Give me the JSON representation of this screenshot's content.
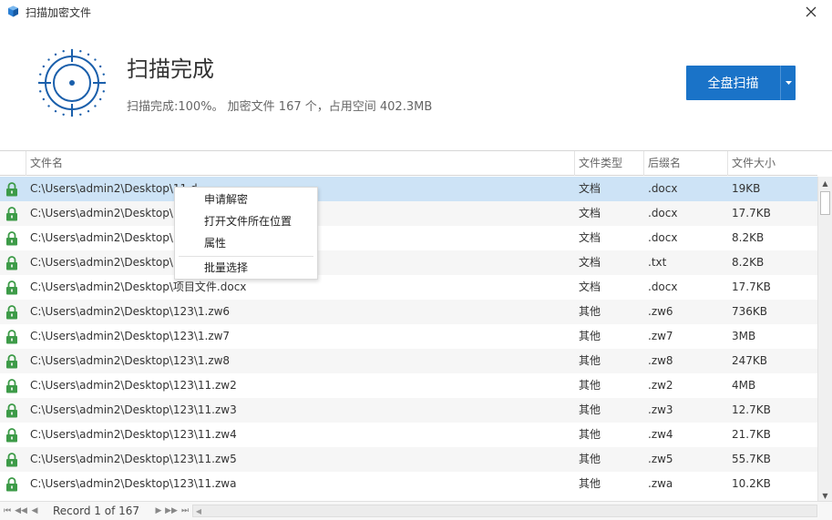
{
  "window": {
    "title": "扫描加密文件",
    "app_icon": "shield-app-icon",
    "close_icon": "close-icon"
  },
  "header": {
    "scan_title": "扫描完成",
    "summary": "扫描完成:100%。 加密文件 167 个，占用空间 402.3MB",
    "full_scan_label": "全盘扫描",
    "full_scan_dropdown_icon": "caret-down-icon",
    "accent_color": "#1a73c8"
  },
  "table": {
    "columns": [
      "文件名",
      "文件类型",
      "后缀名",
      "文件大小"
    ],
    "rows": [
      {
        "name": "C:\\Users\\admin2\\Desktop\\11.d",
        "type": "文档",
        "ext": ".docx",
        "size": "19KB"
      },
      {
        "name": "C:\\Users\\admin2\\Desktop\\",
        "type": "文档",
        "ext": ".docx",
        "size": "17.7KB"
      },
      {
        "name": "C:\\Users\\admin2\\Desktop\\",
        "type": "文档",
        "ext": ".docx",
        "size": "8.2KB"
      },
      {
        "name": "C:\\Users\\admin2\\Desktop\\",
        "type": "文档",
        "ext": ".txt",
        "size": "8.2KB"
      },
      {
        "name": "C:\\Users\\admin2\\Desktop\\项目文件.docx",
        "type": "文档",
        "ext": ".docx",
        "size": "17.7KB"
      },
      {
        "name": "C:\\Users\\admin2\\Desktop\\123\\1.zw6",
        "type": "其他",
        "ext": ".zw6",
        "size": "736KB"
      },
      {
        "name": "C:\\Users\\admin2\\Desktop\\123\\1.zw7",
        "type": "其他",
        "ext": ".zw7",
        "size": "3MB"
      },
      {
        "name": "C:\\Users\\admin2\\Desktop\\123\\1.zw8",
        "type": "其他",
        "ext": ".zw8",
        "size": "247KB"
      },
      {
        "name": "C:\\Users\\admin2\\Desktop\\123\\11.zw2",
        "type": "其他",
        "ext": ".zw2",
        "size": "4MB"
      },
      {
        "name": "C:\\Users\\admin2\\Desktop\\123\\11.zw3",
        "type": "其他",
        "ext": ".zw3",
        "size": "12.7KB"
      },
      {
        "name": "C:\\Users\\admin2\\Desktop\\123\\11.zw4",
        "type": "其他",
        "ext": ".zw4",
        "size": "21.7KB"
      },
      {
        "name": "C:\\Users\\admin2\\Desktop\\123\\11.zw5",
        "type": "其他",
        "ext": ".zw5",
        "size": "55.7KB"
      },
      {
        "name": "C:\\Users\\admin2\\Desktop\\123\\11.zwa",
        "type": "其他",
        "ext": ".zwa",
        "size": "10.2KB"
      }
    ],
    "lock_icon": "lock-icon",
    "lock_color": "#3d9b48",
    "selected_row": 0
  },
  "context_menu": {
    "items": [
      "申请解密",
      "打开文件所在位置",
      "属性",
      "批量选择"
    ]
  },
  "pager": {
    "record_text": "Record 1 of 167",
    "first_icon": "first-page-icon",
    "prev_page_icon": "prev-page-icon",
    "prev_icon": "prev-icon",
    "next_icon": "next-icon",
    "next_page_icon": "next-page-icon",
    "last_icon": "last-page-icon"
  }
}
